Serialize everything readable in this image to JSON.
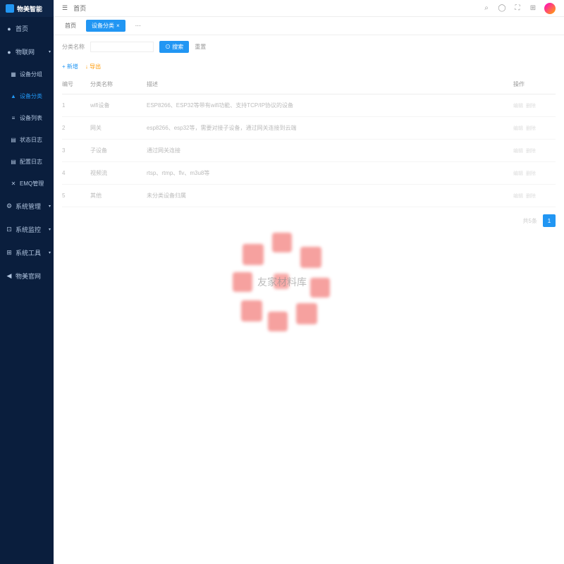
{
  "app": {
    "name": "物美智能"
  },
  "topbar": {
    "breadcrumb": "首页"
  },
  "sidebar": {
    "items": [
      {
        "icon": "●",
        "label": "首页"
      },
      {
        "icon": "●",
        "label": "物联网",
        "expandable": true
      },
      {
        "icon": "▦",
        "label": "设备分组",
        "sub": true
      },
      {
        "icon": "▲",
        "label": "设备分类",
        "sub": true,
        "current": true
      },
      {
        "icon": "≡",
        "label": "设备列表",
        "sub": true
      },
      {
        "icon": "▤",
        "label": "状态日志",
        "sub": true
      },
      {
        "icon": "▤",
        "label": "配置日志",
        "sub": true
      },
      {
        "icon": "✕",
        "label": "EMQ管理",
        "sub": true
      },
      {
        "icon": "⚙",
        "label": "系统管理",
        "expandable": true
      },
      {
        "icon": "⊡",
        "label": "系统监控",
        "expandable": true
      },
      {
        "icon": "⊞",
        "label": "系统工具",
        "expandable": true
      },
      {
        "icon": "◀",
        "label": "物美官网"
      }
    ]
  },
  "tabs": [
    {
      "label": "首页",
      "active": false
    },
    {
      "label": "设备分类",
      "active": true,
      "closable": true
    },
    {
      "label": "···",
      "active": false
    }
  ],
  "search": {
    "label": "分类名称",
    "placeholder": "",
    "searchBtn": "⊙ 搜索",
    "resetBtn": "重置"
  },
  "toolbar": {
    "add": "+ 新增",
    "export": "↓ 导出"
  },
  "table": {
    "headers": [
      "编号",
      "分类名称",
      "描述",
      "操作"
    ],
    "rows": [
      {
        "id": "1",
        "name": "wifi设备",
        "desc": "ESP8266、ESP32等带有wifi功能、支持TCP/IP协议的设备",
        "actions": [
          "编辑",
          "删除"
        ]
      },
      {
        "id": "2",
        "name": "网关",
        "desc": "esp8266、esp32等，需要对接子设备，通过网关连接到云端",
        "actions": [
          "编辑",
          "删除"
        ]
      },
      {
        "id": "3",
        "name": "子设备",
        "desc": "通过网关连接",
        "actions": [
          "编辑",
          "删除"
        ]
      },
      {
        "id": "4",
        "name": "视频流",
        "desc": "rtsp、rtmp、flv、m3u8等",
        "actions": [
          "编辑",
          "删除"
        ]
      },
      {
        "id": "5",
        "name": "其他",
        "desc": "未分类设备归属",
        "actions": [
          "编辑",
          "删除"
        ]
      }
    ]
  },
  "pagination": {
    "info": "共5条",
    "current": "1"
  },
  "watermark": "友家材料库"
}
